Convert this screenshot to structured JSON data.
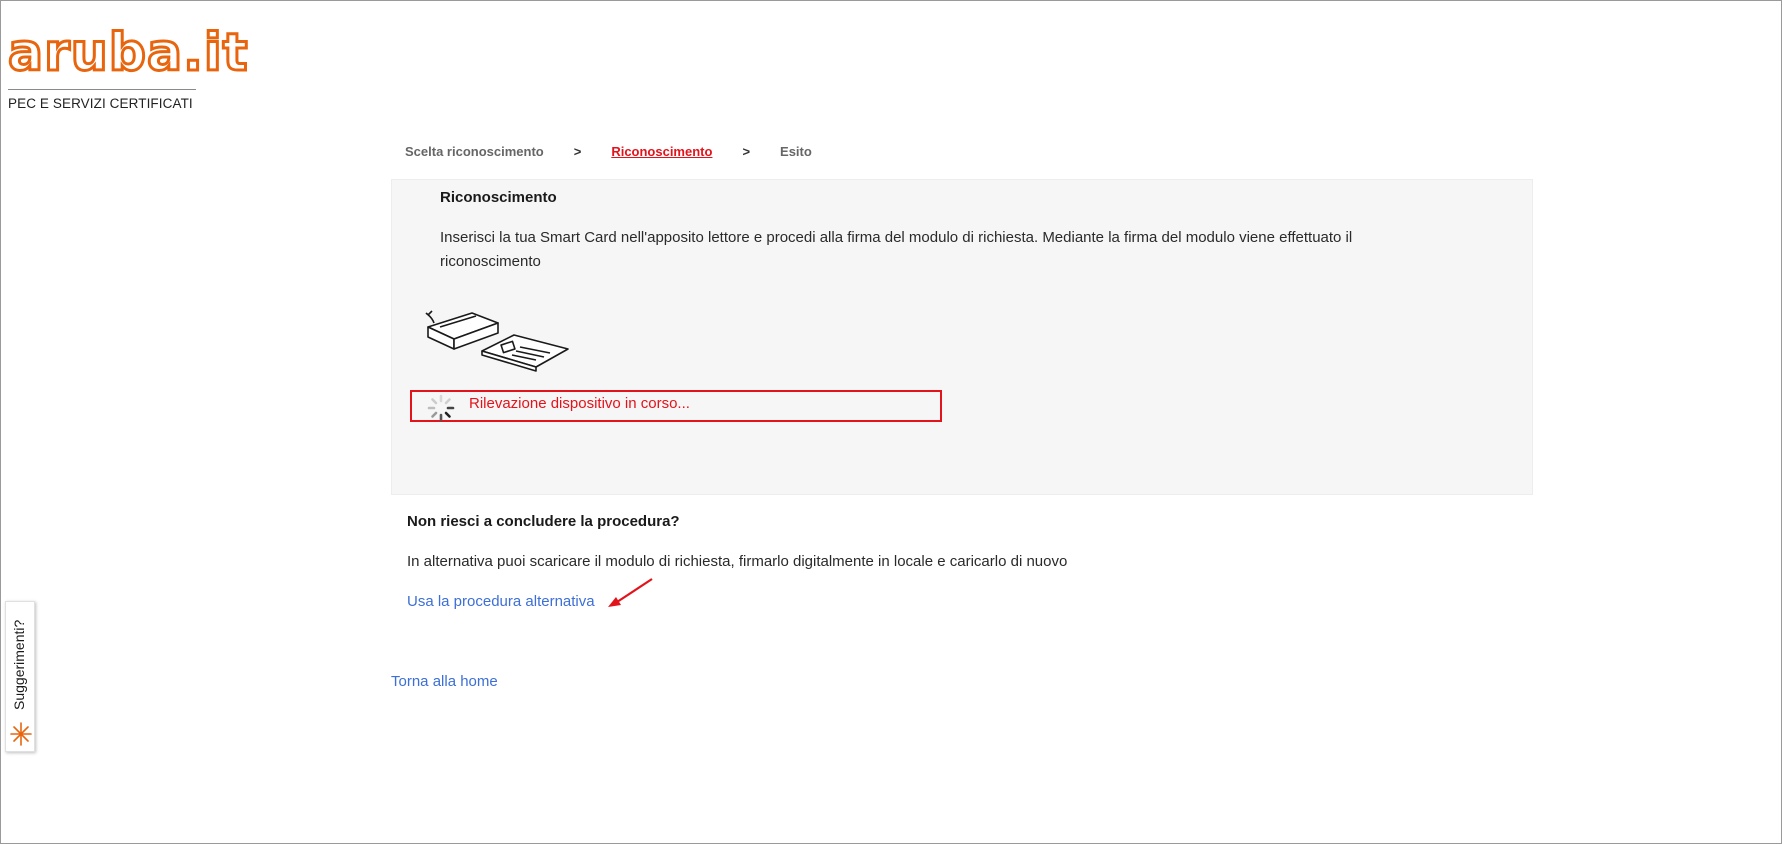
{
  "brand": {
    "logo_text": "aruba.it",
    "tagline": "PEC E SERVIZI CERTIFICATI",
    "accent_color": "#e8650e"
  },
  "steps": [
    {
      "label": "Scelta riconoscimento",
      "active": false
    },
    {
      "label": "Riconoscimento",
      "active": true
    },
    {
      "label": "Esito",
      "active": false
    }
  ],
  "step_separator": ">",
  "panel": {
    "title": "Riconoscimento",
    "instructions": "Inserisci la tua Smart Card nell'apposito lettore e procedi alla firma del modulo di richiesta. Mediante la firma del modulo viene effettuato il riconoscimento",
    "illustration": "smart-card-reader-icon",
    "status_text": "Rilevazione dispositivo in corso...",
    "status_color": "#e3131b"
  },
  "help": {
    "title": "Non riesci a concludere la procedura?",
    "text": "In alternativa puoi scaricare il modulo di richiesta, firmarlo digitalmente in locale e caricarlo di nuovo",
    "alt_link": "Usa la procedura alternativa"
  },
  "home_link": "Torna alla home",
  "feedback": {
    "label": "Suggerimenti?",
    "icon": "sparkle-icon"
  },
  "link_color": "#3d6fd6"
}
